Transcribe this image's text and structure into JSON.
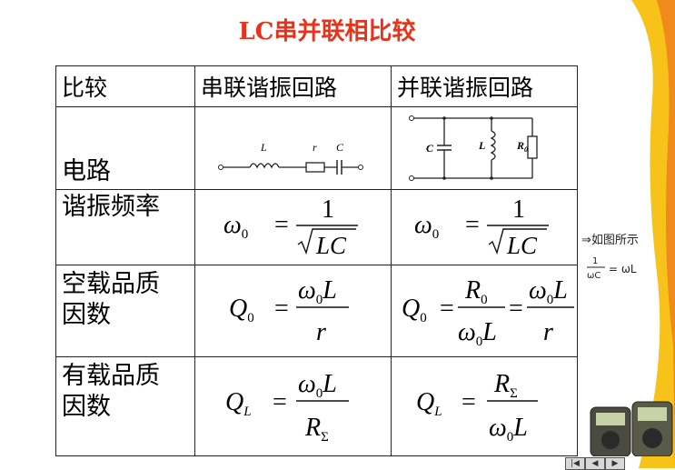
{
  "title": "LC串并联相比较",
  "table": {
    "headers": [
      "比较",
      "串联谐振回路",
      "并联谐振回路"
    ],
    "row_labels": {
      "circuit": "电路",
      "resonance_freq": "谐振频率",
      "unloaded_q_line1": "空载品质",
      "unloaded_q_line2": "因数",
      "loaded_q_line1": "有载品质",
      "loaded_q_line2": "因数"
    },
    "series_circuit_labels": {
      "l": "L",
      "r": "r",
      "c": "C"
    },
    "parallel_circuit_labels": {
      "c": "C",
      "l": "L",
      "r": "R",
      "r_sub": "0"
    },
    "formulas": {
      "omega": "ω",
      "omega_sub": "0",
      "equals": "=",
      "one": "1",
      "lc": "LC",
      "q": "Q",
      "q0_sub": "0",
      "ql_sub": "L",
      "L": "L",
      "r": "r",
      "R": "R",
      "R0_sub": "0",
      "sigma": "Σ"
    }
  },
  "handwritten_note": {
    "line1": "⇒如图所示",
    "frac_num": "1",
    "frac_den": "ωC",
    "rhs": "= ωL"
  },
  "colors": {
    "title": "#e8331c",
    "deco_yellow": "#f7c21a",
    "deco_orange": "#f08a1c"
  }
}
